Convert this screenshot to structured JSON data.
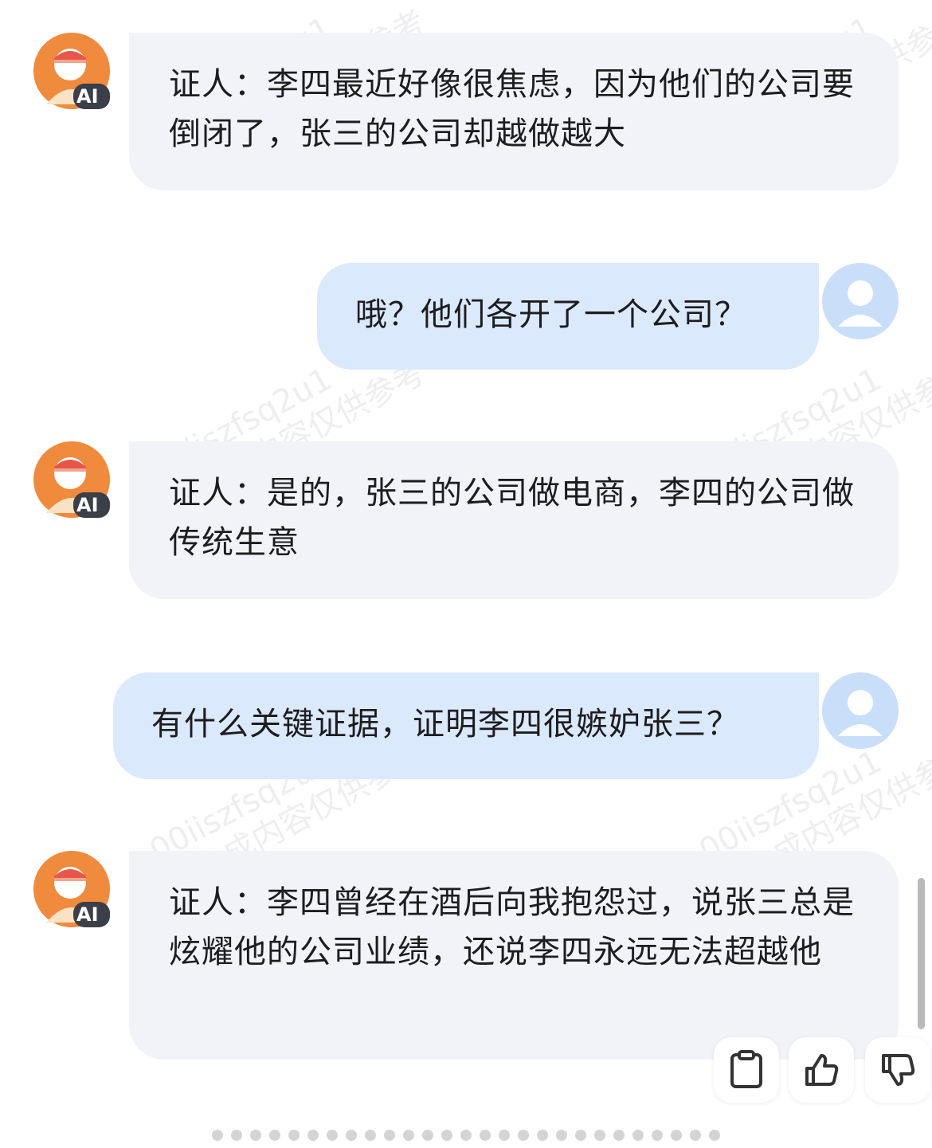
{
  "messages": [
    {
      "role": "ai",
      "text": "证人：李四最近好像很焦虑，因为他们的公司要倒闭了，张三的公司却越做越大"
    },
    {
      "role": "user",
      "text": "哦？他们各开了一个公司？"
    },
    {
      "role": "ai",
      "text": "证人：是的，张三的公司做电商，李四的公司做传统生意"
    },
    {
      "role": "user",
      "text": "有什么关键证据，证明李四很嫉妒张三？"
    },
    {
      "role": "ai",
      "text": "证人：李四曾经在酒后向我抱怨过，说张三总是炫耀他的公司业绩，还说李四永远无法超越他"
    }
  ],
  "avatar_badge": "AI",
  "watermarks": [
    "00iiszfsq2u1",
    "AI生成内容仅供参考"
  ],
  "actions": {
    "copy": "clipboard-icon",
    "like": "thumbs-up-icon",
    "dislike": "thumbs-down-icon"
  },
  "colors": {
    "ai_bubble": "#f1f3f8",
    "user_bubble": "#dbe9fc",
    "ai_avatar": "#f08a3c",
    "user_avatar": "#c9def9"
  }
}
